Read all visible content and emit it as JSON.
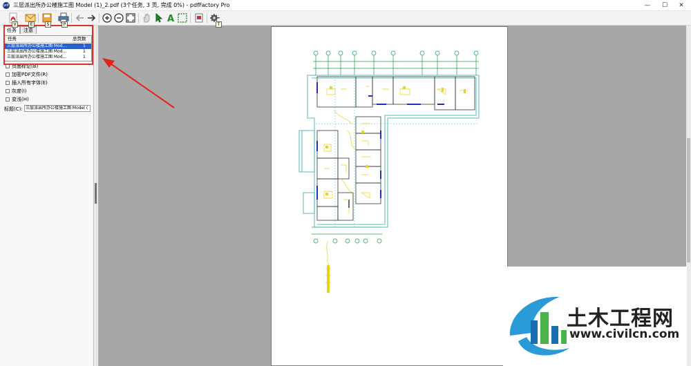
{
  "window": {
    "title": "三层派出所办公楼施工图 Model (1)_2.pdf (3个任务, 3 页, 完成 0%) - pdfFactory Pro",
    "app_icon": "pdfFactory-icon",
    "controls": [
      "—",
      "☐",
      "✕"
    ]
  },
  "toolbar": {
    "keys": {
      "pdf": "V",
      "email": "E",
      "save": "S",
      "print": "P",
      "settings": "T"
    },
    "icons": [
      "pdf-icon",
      "email-icon",
      "save-icon",
      "print-icon",
      "back-icon",
      "forward-icon",
      "zoom-in-icon",
      "zoom-out-icon",
      "fit-page-icon",
      "hand-icon",
      "pointer-icon",
      "text-tool-icon",
      "select-area-icon",
      "document-icon",
      "settings-icon"
    ]
  },
  "left_panel": {
    "tabs": [
      "任务",
      "注意"
    ],
    "task_list": {
      "headers": [
        "任务",
        "总页数"
      ],
      "rows": [
        {
          "name": "三层派出所办公楼施工图 Mod...",
          "pages": "1",
          "selected": true
        },
        {
          "name": "三层派出所办公楼施工图 Mod...",
          "pages": "1",
          "selected": false
        },
        {
          "name": "三层派出所办公楼施工图 Mod...",
          "pages": "1",
          "selected": false
        }
      ]
    },
    "options": [
      "页面标记(B)",
      "加密PDF文件(R)",
      "插入所有字体(E)",
      "灰度(I)",
      "变浅(H)"
    ],
    "title_label": "标题(C):",
    "title_value": "三层派出所办公楼施工图 Model ("
  },
  "watermark": {
    "brand_cn": "土木工程网",
    "url": "www.civilcn.com",
    "accent": "#2a9bd6"
  }
}
